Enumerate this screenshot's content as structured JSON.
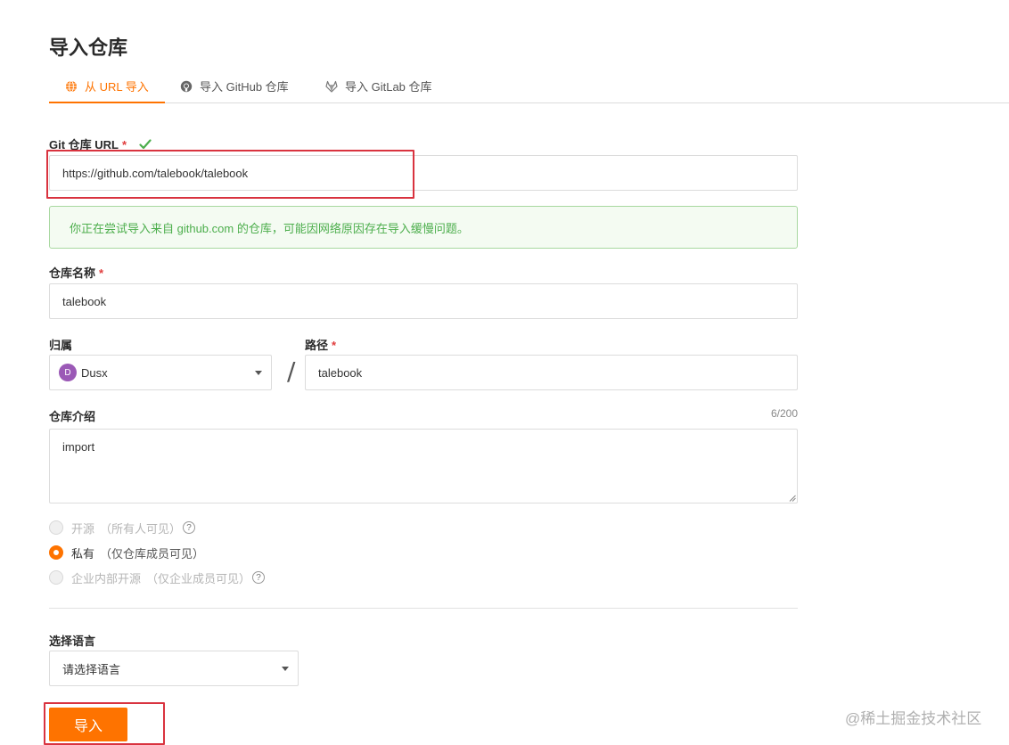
{
  "page": {
    "title": "导入仓库"
  },
  "tabs": [
    {
      "label": "从 URL 导入",
      "icon": "globe-icon",
      "active": true
    },
    {
      "label": "导入 GitHub 仓库",
      "icon": "github-icon",
      "active": false
    },
    {
      "label": "导入 GitLab 仓库",
      "icon": "gitlab-icon",
      "active": false
    }
  ],
  "git_url": {
    "label": "Git 仓库 URL",
    "required_mark": "*",
    "value": "https://github.com/talebook/talebook"
  },
  "alert": {
    "text": "你正在尝试导入来自 github.com 的仓库，可能因网络原因存在导入缓慢问题。"
  },
  "repo_name": {
    "label": "仓库名称",
    "required_mark": "*",
    "value": "talebook"
  },
  "owner": {
    "label": "归属",
    "value": "Dusx",
    "avatar_letter": "D"
  },
  "path": {
    "label": "路径",
    "required_mark": "*",
    "value": "talebook",
    "separator": "/"
  },
  "description": {
    "label": "仓库介绍",
    "counter": "6/200",
    "value": "import"
  },
  "visibility": {
    "options": [
      {
        "label": "开源",
        "hint": "（所有人可见）",
        "help": "?",
        "checked": false,
        "disabled": true
      },
      {
        "label": "私有",
        "hint": "（仅仓库成员可见）",
        "checked": true,
        "disabled": false
      },
      {
        "label": "企业内部开源",
        "hint": "（仅企业成员可见）",
        "help": "?",
        "checked": false,
        "disabled": true
      }
    ]
  },
  "language": {
    "label": "选择语言",
    "placeholder": "请选择语言"
  },
  "submit": {
    "label": "导入"
  },
  "watermark": {
    "text": "@稀土掘金技术社区"
  },
  "colors": {
    "accent": "#fe7300",
    "success": "#4cae4c",
    "required": "#e03c3c",
    "highlight": "#d9333f",
    "avatar": "#9b59b6"
  }
}
